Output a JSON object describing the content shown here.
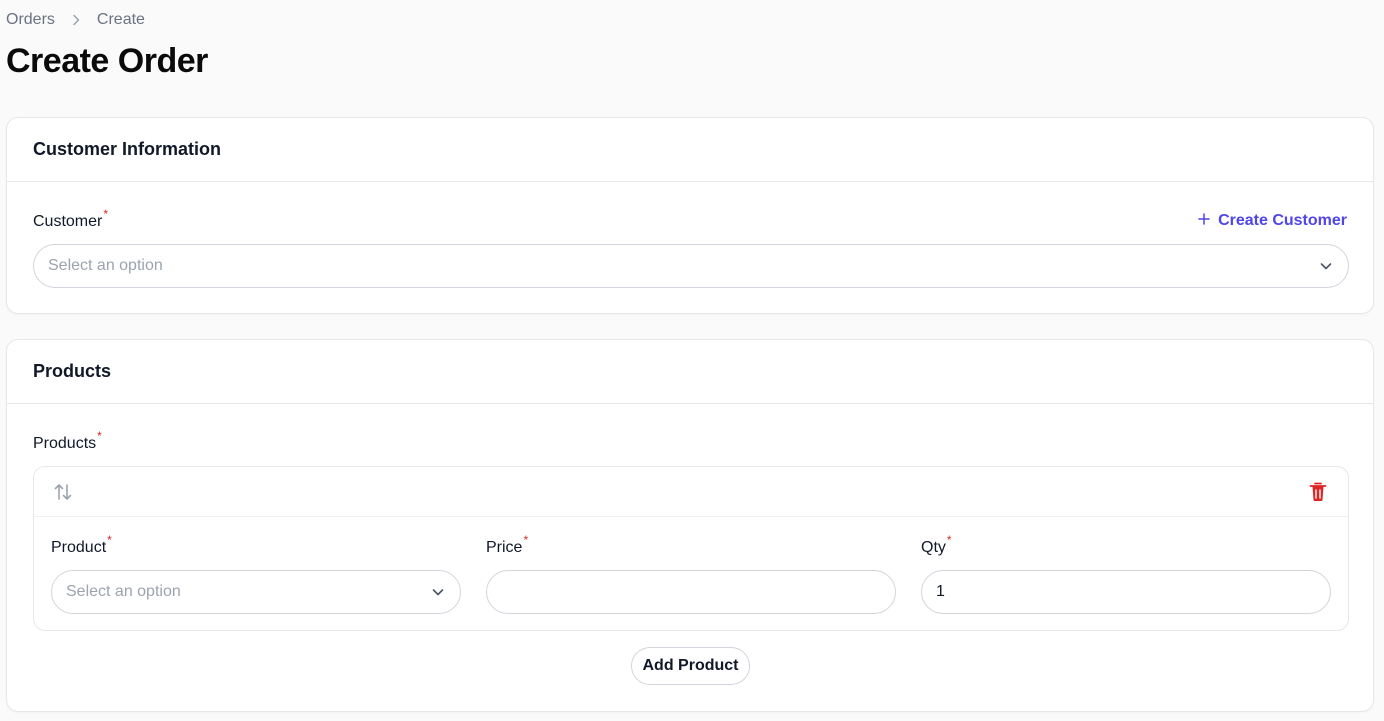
{
  "breadcrumb": {
    "items": [
      "Orders",
      "Create"
    ]
  },
  "page": {
    "title": "Create Order"
  },
  "customer_section": {
    "title": "Customer Information",
    "customer_label": "Customer",
    "required_mark": "*",
    "create_customer_label": "Create Customer",
    "customer_placeholder": "Select an option"
  },
  "products_section": {
    "title": "Products",
    "field_label": "Products",
    "item": {
      "product_label": "Product",
      "product_placeholder": "Select an option",
      "price_label": "Price",
      "price_value": "",
      "qty_label": "Qty",
      "qty_value": "1"
    },
    "add_button_label": "Add Product"
  },
  "colors": {
    "accent": "#4f46e5",
    "danger": "#dc2626",
    "border": "#e5e7eb",
    "background": "#fafafa"
  },
  "icons": [
    "chevron-right-icon",
    "plus-icon",
    "chevron-down-icon",
    "reorder-arrows-icon",
    "trash-icon"
  ]
}
